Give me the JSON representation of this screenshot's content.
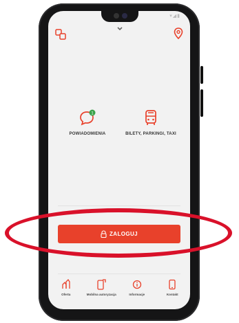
{
  "notifications": {
    "label": "POWIADOMIENIA",
    "badge": "1"
  },
  "tickets": {
    "label": "BILETY, PARKINGI, TAXI"
  },
  "login": {
    "label": "ZALOGUJ"
  },
  "bottom_nav": [
    {
      "label": "Oferta",
      "icon": "offer-icon"
    },
    {
      "label": "Mobilna autoryzacja",
      "icon": "mobile-authorization-icon"
    },
    {
      "label": "Informacje",
      "icon": "info-icon"
    },
    {
      "label": "Kontakt",
      "icon": "contact-icon"
    }
  ],
  "colors": {
    "accent": "#e8412b",
    "highlight_ring": "#d9112a",
    "badge": "#3aa34a"
  }
}
